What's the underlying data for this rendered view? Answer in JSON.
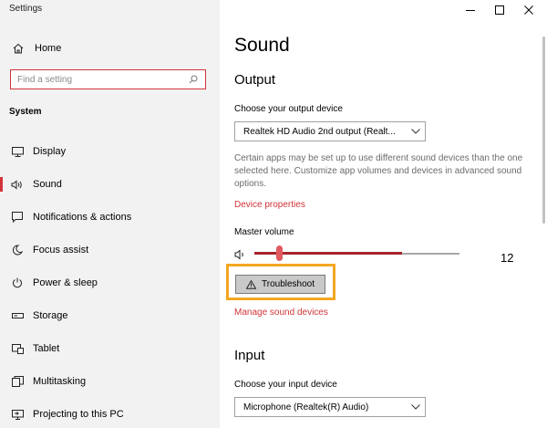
{
  "window": {
    "title": "Settings"
  },
  "sidebar": {
    "home_label": "Home",
    "search_placeholder": "Find a setting",
    "section_title": "System",
    "items": [
      {
        "label": "Display",
        "icon": "display-icon"
      },
      {
        "label": "Sound",
        "icon": "speaker-icon",
        "active": true
      },
      {
        "label": "Notifications & actions",
        "icon": "notifications-icon"
      },
      {
        "label": "Focus assist",
        "icon": "moon-icon"
      },
      {
        "label": "Power & sleep",
        "icon": "power-icon"
      },
      {
        "label": "Storage",
        "icon": "storage-icon"
      },
      {
        "label": "Tablet",
        "icon": "tablet-icon"
      },
      {
        "label": "Multitasking",
        "icon": "multitasking-icon"
      },
      {
        "label": "Projecting to this PC",
        "icon": "projecting-icon"
      }
    ]
  },
  "main": {
    "title": "Sound",
    "output": {
      "heading": "Output",
      "device_label": "Choose your output device",
      "device_value": "Realtek HD Audio 2nd output (Realt...",
      "description": "Certain apps may be set up to use different sound devices than the one selected here. Customize app volumes and devices in advanced sound options.",
      "device_properties_link": "Device properties",
      "master_volume_label": "Master volume",
      "volume_value": "12",
      "volume_level": 0.12,
      "troubleshoot_label": "Troubleshoot",
      "manage_link": "Manage sound devices"
    },
    "input": {
      "heading": "Input",
      "device_label": "Choose your input device",
      "device_value": "Microphone (Realtek(R) Audio)"
    }
  },
  "colors": {
    "accent": "#d13438",
    "slider_fill": "#a4262c",
    "highlight": "#f5a623",
    "sidebar_bg": "#f2f2f2"
  }
}
